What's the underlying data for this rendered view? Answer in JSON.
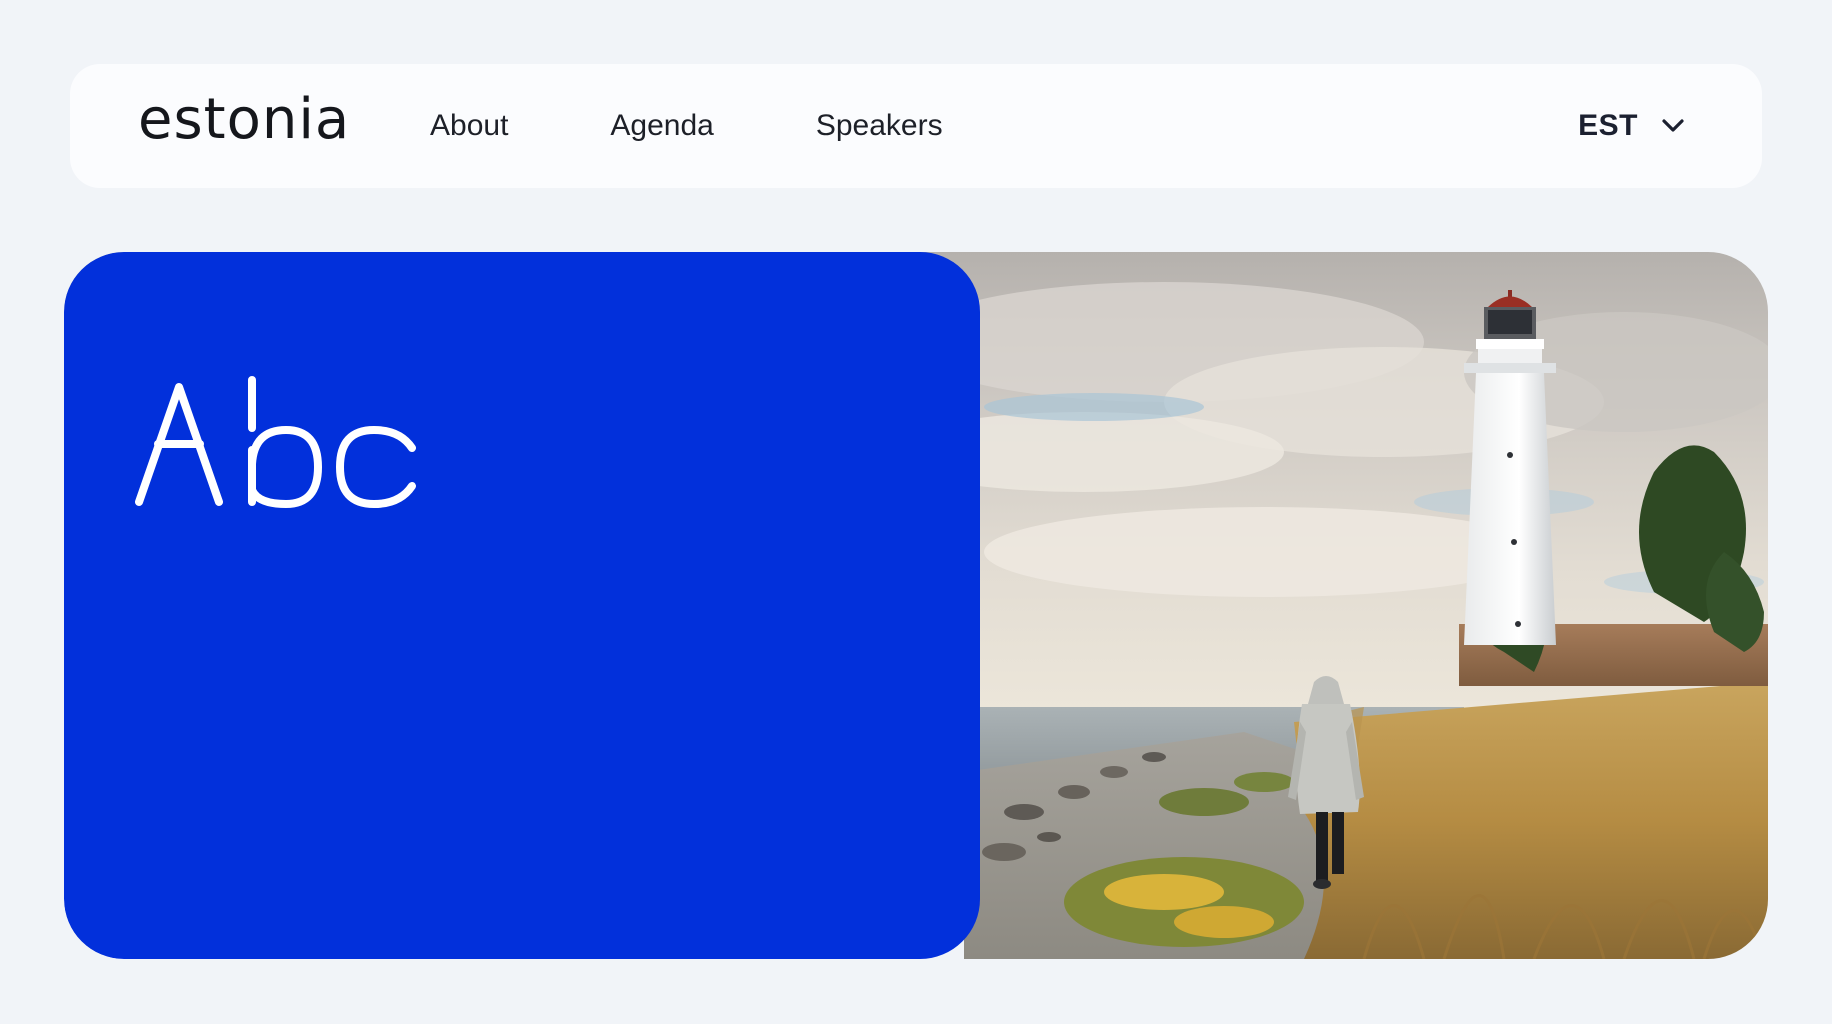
{
  "brand": {
    "logo_text": "estonia"
  },
  "nav": {
    "links": [
      {
        "label": "About"
      },
      {
        "label": "Agenda"
      },
      {
        "label": "Speakers"
      }
    ],
    "language": {
      "selected": "EST"
    }
  },
  "hero": {
    "headline": "Abc",
    "card_color": "#0230db",
    "image_alt": "Person walking along a rocky coastal path toward a white lighthouse"
  },
  "icons": {
    "language_toggle": "chevron-down-icon"
  }
}
